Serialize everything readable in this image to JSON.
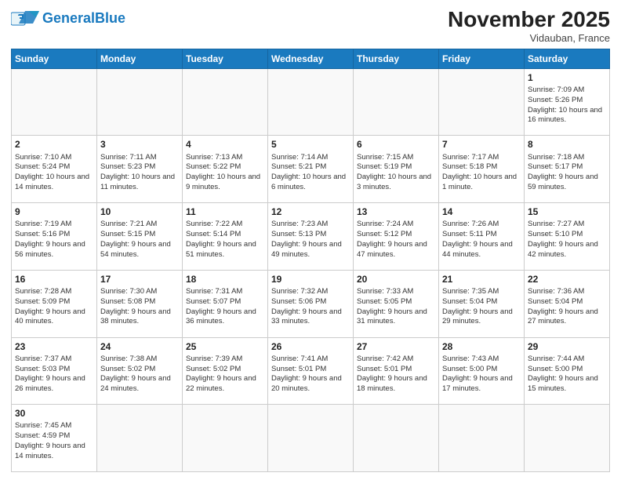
{
  "header": {
    "logo_general": "General",
    "logo_blue": "Blue",
    "month_title": "November 2025",
    "location": "Vidauban, France"
  },
  "weekdays": [
    "Sunday",
    "Monday",
    "Tuesday",
    "Wednesday",
    "Thursday",
    "Friday",
    "Saturday"
  ],
  "weeks": [
    [
      {
        "day": "",
        "info": ""
      },
      {
        "day": "",
        "info": ""
      },
      {
        "day": "",
        "info": ""
      },
      {
        "day": "",
        "info": ""
      },
      {
        "day": "",
        "info": ""
      },
      {
        "day": "",
        "info": ""
      },
      {
        "day": "1",
        "info": "Sunrise: 7:09 AM\nSunset: 5:26 PM\nDaylight: 10 hours and 16 minutes."
      }
    ],
    [
      {
        "day": "2",
        "info": "Sunrise: 7:10 AM\nSunset: 5:24 PM\nDaylight: 10 hours and 14 minutes."
      },
      {
        "day": "3",
        "info": "Sunrise: 7:11 AM\nSunset: 5:23 PM\nDaylight: 10 hours and 11 minutes."
      },
      {
        "day": "4",
        "info": "Sunrise: 7:13 AM\nSunset: 5:22 PM\nDaylight: 10 hours and 9 minutes."
      },
      {
        "day": "5",
        "info": "Sunrise: 7:14 AM\nSunset: 5:21 PM\nDaylight: 10 hours and 6 minutes."
      },
      {
        "day": "6",
        "info": "Sunrise: 7:15 AM\nSunset: 5:19 PM\nDaylight: 10 hours and 3 minutes."
      },
      {
        "day": "7",
        "info": "Sunrise: 7:17 AM\nSunset: 5:18 PM\nDaylight: 10 hours and 1 minute."
      },
      {
        "day": "8",
        "info": "Sunrise: 7:18 AM\nSunset: 5:17 PM\nDaylight: 9 hours and 59 minutes."
      }
    ],
    [
      {
        "day": "9",
        "info": "Sunrise: 7:19 AM\nSunset: 5:16 PM\nDaylight: 9 hours and 56 minutes."
      },
      {
        "day": "10",
        "info": "Sunrise: 7:21 AM\nSunset: 5:15 PM\nDaylight: 9 hours and 54 minutes."
      },
      {
        "day": "11",
        "info": "Sunrise: 7:22 AM\nSunset: 5:14 PM\nDaylight: 9 hours and 51 minutes."
      },
      {
        "day": "12",
        "info": "Sunrise: 7:23 AM\nSunset: 5:13 PM\nDaylight: 9 hours and 49 minutes."
      },
      {
        "day": "13",
        "info": "Sunrise: 7:24 AM\nSunset: 5:12 PM\nDaylight: 9 hours and 47 minutes."
      },
      {
        "day": "14",
        "info": "Sunrise: 7:26 AM\nSunset: 5:11 PM\nDaylight: 9 hours and 44 minutes."
      },
      {
        "day": "15",
        "info": "Sunrise: 7:27 AM\nSunset: 5:10 PM\nDaylight: 9 hours and 42 minutes."
      }
    ],
    [
      {
        "day": "16",
        "info": "Sunrise: 7:28 AM\nSunset: 5:09 PM\nDaylight: 9 hours and 40 minutes."
      },
      {
        "day": "17",
        "info": "Sunrise: 7:30 AM\nSunset: 5:08 PM\nDaylight: 9 hours and 38 minutes."
      },
      {
        "day": "18",
        "info": "Sunrise: 7:31 AM\nSunset: 5:07 PM\nDaylight: 9 hours and 36 minutes."
      },
      {
        "day": "19",
        "info": "Sunrise: 7:32 AM\nSunset: 5:06 PM\nDaylight: 9 hours and 33 minutes."
      },
      {
        "day": "20",
        "info": "Sunrise: 7:33 AM\nSunset: 5:05 PM\nDaylight: 9 hours and 31 minutes."
      },
      {
        "day": "21",
        "info": "Sunrise: 7:35 AM\nSunset: 5:04 PM\nDaylight: 9 hours and 29 minutes."
      },
      {
        "day": "22",
        "info": "Sunrise: 7:36 AM\nSunset: 5:04 PM\nDaylight: 9 hours and 27 minutes."
      }
    ],
    [
      {
        "day": "23",
        "info": "Sunrise: 7:37 AM\nSunset: 5:03 PM\nDaylight: 9 hours and 26 minutes."
      },
      {
        "day": "24",
        "info": "Sunrise: 7:38 AM\nSunset: 5:02 PM\nDaylight: 9 hours and 24 minutes."
      },
      {
        "day": "25",
        "info": "Sunrise: 7:39 AM\nSunset: 5:02 PM\nDaylight: 9 hours and 22 minutes."
      },
      {
        "day": "26",
        "info": "Sunrise: 7:41 AM\nSunset: 5:01 PM\nDaylight: 9 hours and 20 minutes."
      },
      {
        "day": "27",
        "info": "Sunrise: 7:42 AM\nSunset: 5:01 PM\nDaylight: 9 hours and 18 minutes."
      },
      {
        "day": "28",
        "info": "Sunrise: 7:43 AM\nSunset: 5:00 PM\nDaylight: 9 hours and 17 minutes."
      },
      {
        "day": "29",
        "info": "Sunrise: 7:44 AM\nSunset: 5:00 PM\nDaylight: 9 hours and 15 minutes."
      }
    ],
    [
      {
        "day": "30",
        "info": "Sunrise: 7:45 AM\nSunset: 4:59 PM\nDaylight: 9 hours and 14 minutes."
      },
      {
        "day": "",
        "info": ""
      },
      {
        "day": "",
        "info": ""
      },
      {
        "day": "",
        "info": ""
      },
      {
        "day": "",
        "info": ""
      },
      {
        "day": "",
        "info": ""
      },
      {
        "day": "",
        "info": ""
      }
    ]
  ]
}
